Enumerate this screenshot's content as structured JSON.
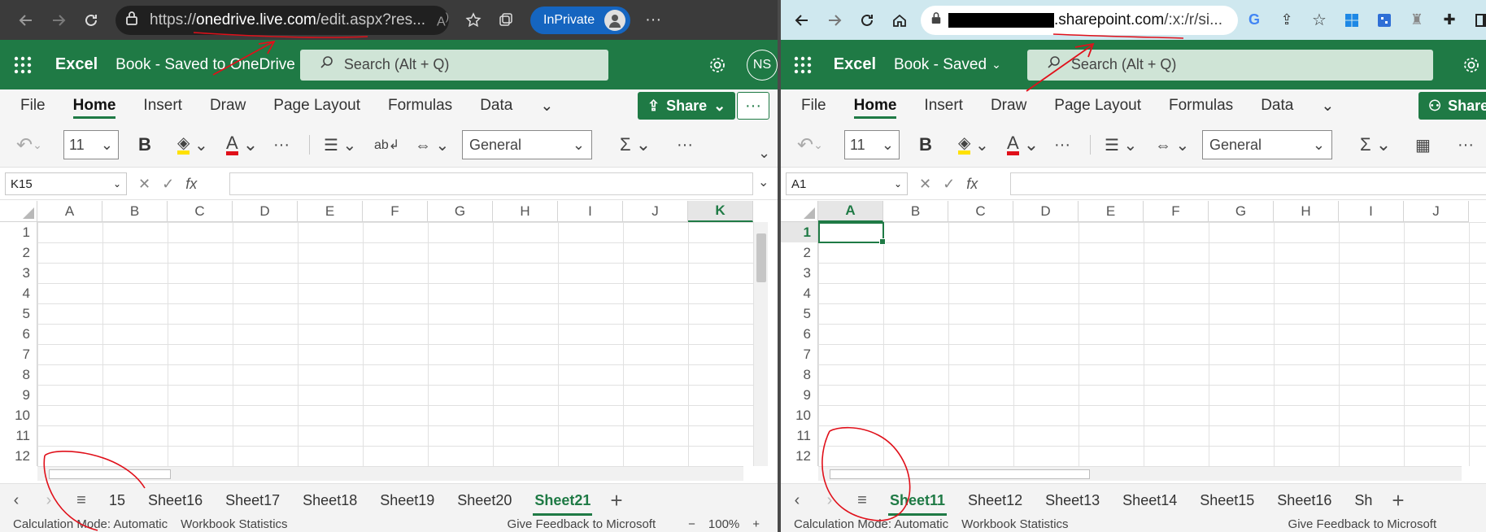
{
  "left": {
    "browser": {
      "url_prefix": "https://",
      "url_host": "onedrive.live.com",
      "url_rest": "/edit.aspx?res...",
      "inprivate_label": "InPrivate"
    },
    "excel": {
      "app_name": "Excel",
      "book_title": "Book - Saved to OneDrive",
      "search_placeholder": "Search (Alt + Q)",
      "profile_initials": "NS"
    },
    "tabs": [
      "File",
      "Home",
      "Insert",
      "Draw",
      "Page Layout",
      "Formulas",
      "Data"
    ],
    "share_label": "Share",
    "font_size": "11",
    "number_format": "General",
    "name_box": "K15",
    "columns": [
      "A",
      "B",
      "C",
      "D",
      "E",
      "F",
      "G",
      "H",
      "I",
      "J",
      "K"
    ],
    "selected_column": "K",
    "rows": [
      "1",
      "2",
      "3",
      "4",
      "5",
      "6",
      "7",
      "8",
      "9",
      "10",
      "11",
      "12"
    ],
    "sheets": [
      "15",
      "Sheet16",
      "Sheet17",
      "Sheet18",
      "Sheet19",
      "Sheet20",
      "Sheet21"
    ],
    "active_sheet": "Sheet21",
    "status": {
      "calc_mode": "Calculation Mode: Automatic",
      "workbook_stats": "Workbook Statistics",
      "feedback": "Give Feedback to Microsoft",
      "zoom": "100%"
    }
  },
  "right": {
    "browser": {
      "url_host": ".sharepoint.com",
      "url_rest": "/:x:/r/si..."
    },
    "excel": {
      "app_name": "Excel",
      "book_title": "Book - Saved",
      "search_placeholder": "Search (Alt + Q)"
    },
    "tabs": [
      "File",
      "Home",
      "Insert",
      "Draw",
      "Page Layout",
      "Formulas",
      "Data"
    ],
    "share_label": "Share",
    "font_size": "11",
    "number_format": "General",
    "name_box": "A1",
    "columns": [
      "A",
      "B",
      "C",
      "D",
      "E",
      "F",
      "G",
      "H",
      "I",
      "J"
    ],
    "selected_column": "A",
    "rows": [
      "1",
      "2",
      "3",
      "4",
      "5",
      "6",
      "7",
      "8",
      "9",
      "10",
      "11",
      "12"
    ],
    "selected_row": "1",
    "sheets": [
      "Sheet11",
      "Sheet12",
      "Sheet13",
      "Sheet14",
      "Sheet15",
      "Sheet16",
      "Sh"
    ],
    "active_sheet": "Sheet11",
    "status": {
      "calc_mode": "Calculation Mode: Automatic",
      "workbook_stats": "Workbook Statistics",
      "feedback": "Give Feedback to Microsoft"
    }
  },
  "colors": {
    "excel_green": "#1f7a45",
    "annotation_red": "#e0101a",
    "inprivate_blue": "#1565c0"
  }
}
